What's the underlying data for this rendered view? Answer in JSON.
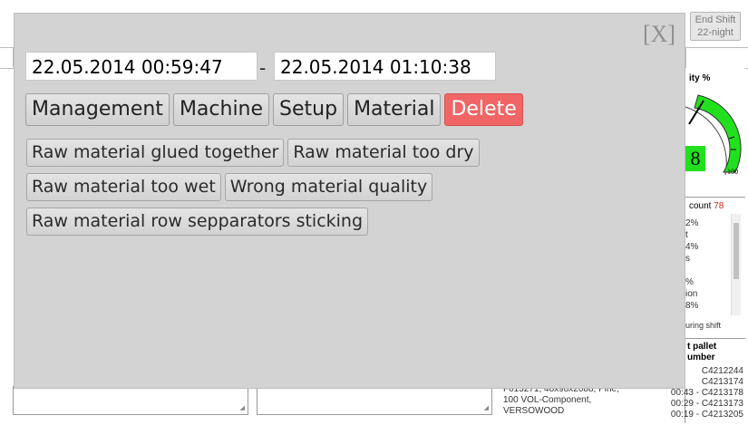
{
  "header": {
    "end_shift_line1": "End Shift",
    "end_shift_line2": "22-night"
  },
  "right_panel": {
    "gauge_title": "ity %",
    "gauge_value": "8",
    "gauge_max": "100",
    "count_label": "count",
    "count_value": "78",
    "count_items": [
      "2%",
      "t",
      "4%",
      "s",
      "",
      "%",
      "ion",
      "8%"
    ],
    "count_footer": "uring shift",
    "pallet_title_line1": "t pallet",
    "pallet_title_line2": "umber",
    "pallet_items": [
      "C4212244",
      "C4213174",
      "00:43 - C4213178",
      "00:29 - C4213173",
      "00:19 - C4213205"
    ]
  },
  "bottom_info": {
    "line1": "F015271, 48x98x2088, Pine,",
    "line2": "100 VOL-Component,",
    "line3": "VERSOWOOD"
  },
  "modal": {
    "close_label": "[X]",
    "date_from": "22.05.2014 00:59:47",
    "date_separator": "-",
    "date_to": "22.05.2014 01:10:38",
    "tabs": [
      "Management",
      "Machine",
      "Setup",
      "Material",
      "Delete"
    ],
    "reasons_row1": [
      "Raw material glued together",
      "Raw material too dry"
    ],
    "reasons_row2": [
      "Raw material too wet",
      "Wrong material quality"
    ],
    "reasons_row3": [
      "Raw material row sepparators sticking"
    ]
  },
  "colors": {
    "delete": "#f06565",
    "gauge_green": "#22e01e",
    "count_red": "#d02020"
  }
}
